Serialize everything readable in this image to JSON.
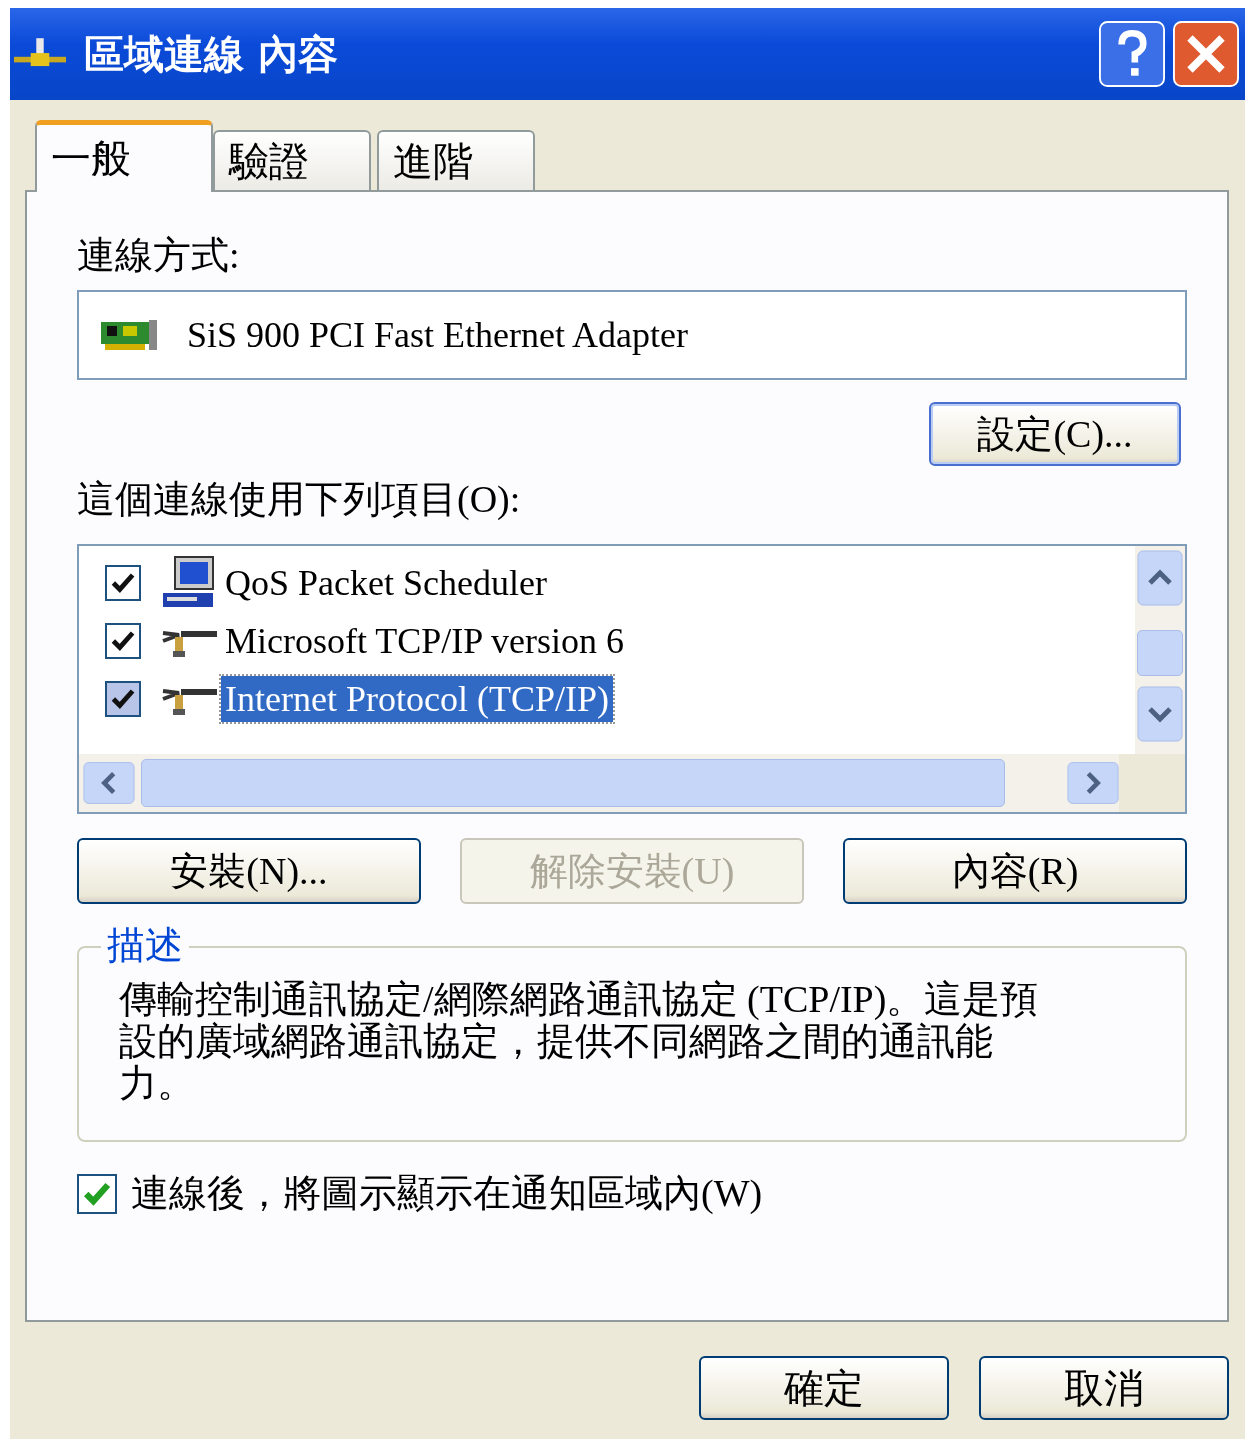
{
  "window": {
    "title": "區域連線 內容"
  },
  "tabs": [
    {
      "label": "一般",
      "selected": true
    },
    {
      "label": "驗證",
      "selected": false
    },
    {
      "label": "進階",
      "selected": false
    }
  ],
  "connect_using": {
    "label": "連線方式:",
    "adapter": "SiS 900 PCI Fast Ethernet Adapter",
    "configure_button": "設定(C)..."
  },
  "items_label": "這個連線使用下列項目(O):",
  "items": [
    {
      "kind": "scheduler",
      "label": "QoS Packet Scheduler",
      "checked": true,
      "selected": false
    },
    {
      "kind": "protocol",
      "label": "Microsoft TCP/IP version 6",
      "checked": true,
      "selected": false
    },
    {
      "kind": "protocol",
      "label": "Internet Protocol (TCP/IP)",
      "checked": true,
      "selected": true
    }
  ],
  "item_buttons": [
    {
      "label": "安裝(N)...",
      "disabled": false
    },
    {
      "label": "解除安裝(U)",
      "disabled": true
    },
    {
      "label": "內容(R)",
      "disabled": false
    }
  ],
  "description": {
    "title": "描述",
    "text": "傳輸控制通訊協定/網際網路通訊協定 (TCP/IP)。這是預設的廣域網路通訊協定，提供不同網路之間的通訊能力。"
  },
  "notify": {
    "label": "連線後，將圖示顯示在通知區域內(W)",
    "checked": true
  },
  "footer_buttons": [
    "確定",
    "取消"
  ]
}
